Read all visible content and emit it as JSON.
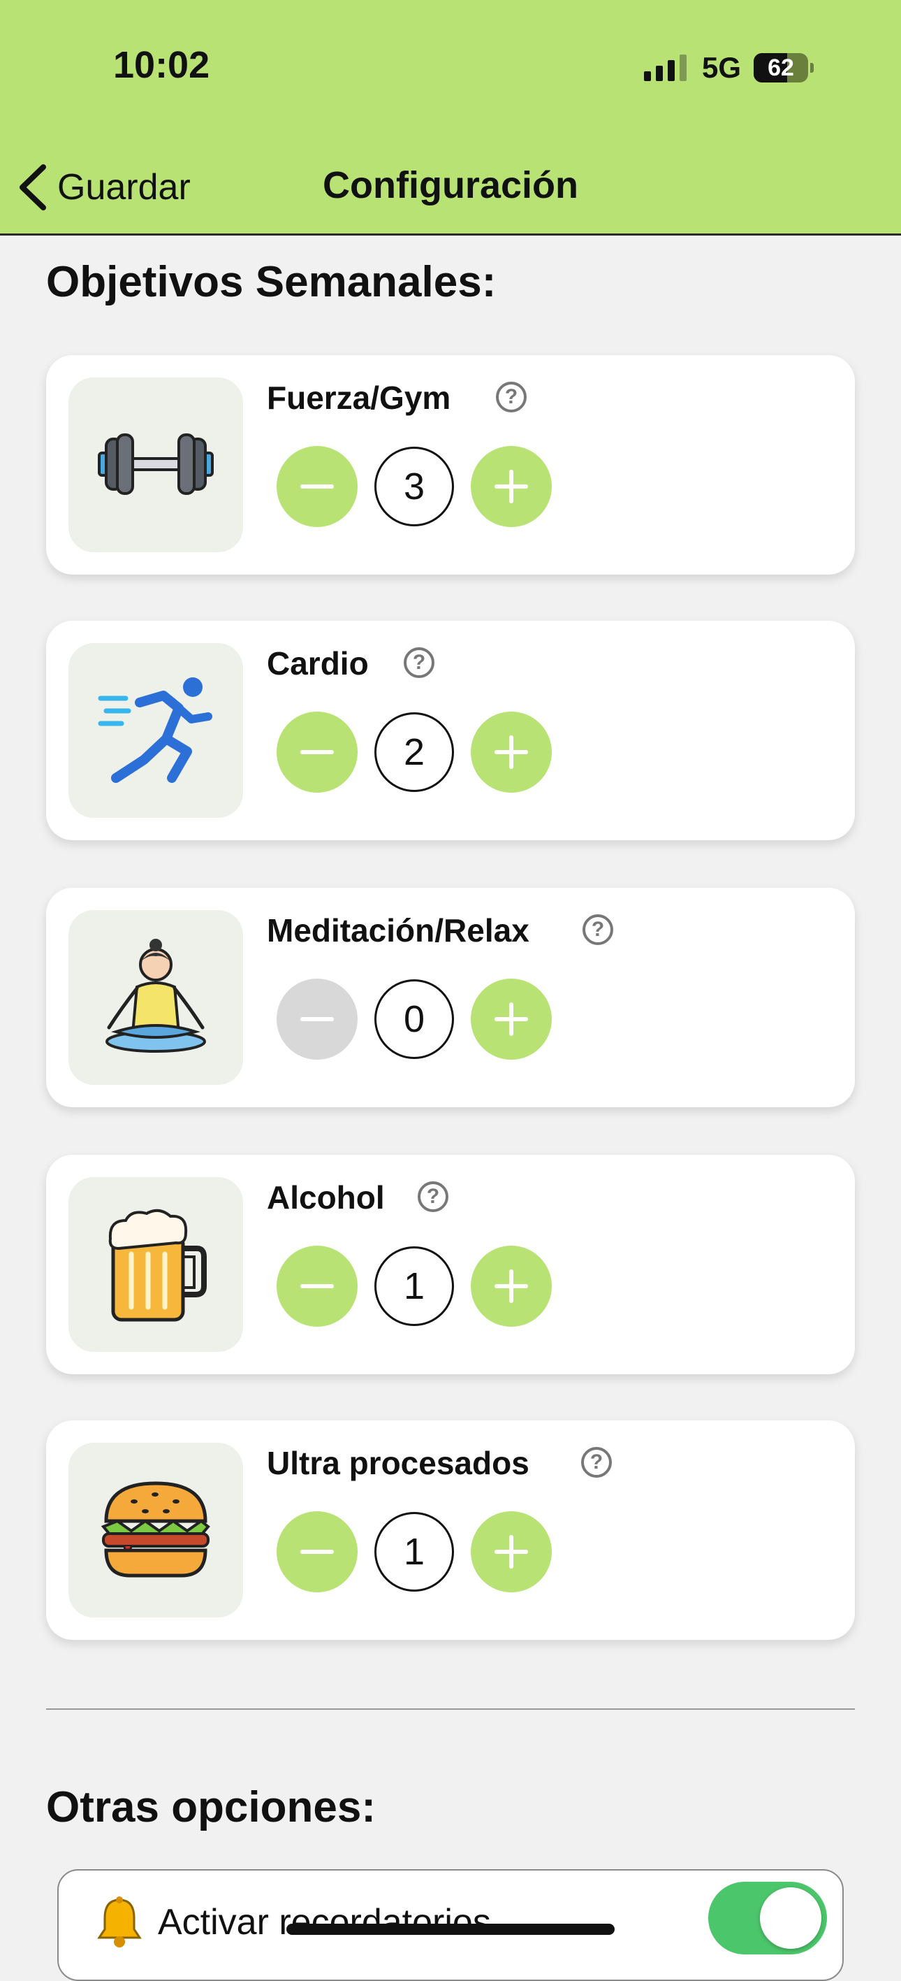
{
  "status_bar": {
    "time": "10:02",
    "network": "5G",
    "battery": "62",
    "battery_level": 0.62
  },
  "nav": {
    "back_label": "Guardar",
    "title": "Configuración"
  },
  "goals": {
    "section_title": "Objetivos Semanales:",
    "items": [
      {
        "name": "Fuerza/Gym",
        "value": "3",
        "icon": "dumbbell-icon",
        "minus_enabled": true
      },
      {
        "name": "Cardio",
        "value": "2",
        "icon": "runner-icon",
        "minus_enabled": true
      },
      {
        "name": "Meditación/Relax",
        "value": "0",
        "icon": "meditation-icon",
        "minus_enabled": false
      },
      {
        "name": "Alcohol",
        "value": "1",
        "icon": "beer-mug-icon",
        "minus_enabled": true
      },
      {
        "name": "Ultra procesados",
        "value": "1",
        "icon": "burger-icon",
        "minus_enabled": true
      }
    ]
  },
  "other": {
    "section_title": "Otras opciones:",
    "reminders_label": "Activar recordatorios",
    "reminders_on": true
  },
  "colors": {
    "accent": "#b8e374",
    "disabled": "#d8d8d8",
    "toggle_on": "#4cc66a",
    "background": "#f1f1f1"
  }
}
